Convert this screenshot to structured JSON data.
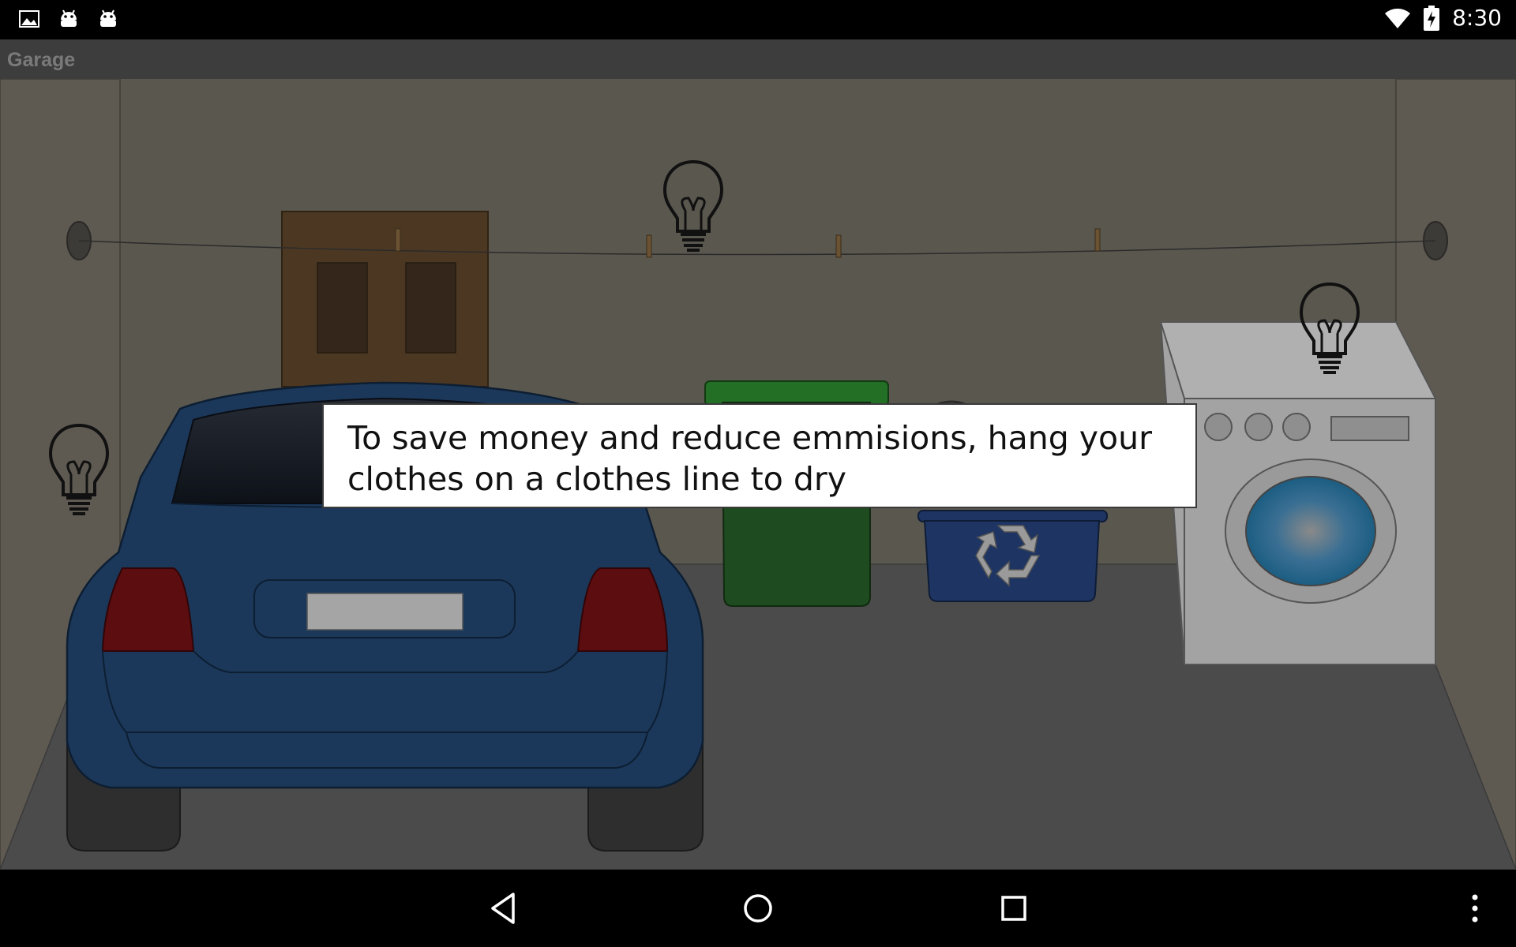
{
  "status_bar": {
    "time": "8:30",
    "icons": [
      "image-notification-icon",
      "android-notification-icon",
      "android-notification-icon",
      "wifi-icon",
      "battery-charging-icon"
    ]
  },
  "app": {
    "title": "Garage"
  },
  "tip": {
    "text": "To save money and reduce emmisions, hang your clothes on a clothes line to dry"
  },
  "scene": {
    "objects": [
      "cabinet",
      "clothesline",
      "car",
      "trash-bin",
      "recycling-bin",
      "washing-machine"
    ],
    "hint_icons": [
      "lightbulb-icon",
      "lightbulb-icon",
      "lightbulb-icon",
      "lightbulb-icon"
    ]
  },
  "colors": {
    "wall": "#5a574f",
    "floor": "#4b4b4b",
    "car": "#1b385a",
    "trash_bin": "#1e4b1f",
    "recycling_bin": "#1e3563",
    "washer": "#a3a3a3",
    "cabinet": "#4c3822"
  },
  "nav_bar": {
    "buttons": [
      "back-button",
      "home-button",
      "recents-button",
      "menu-button"
    ]
  }
}
